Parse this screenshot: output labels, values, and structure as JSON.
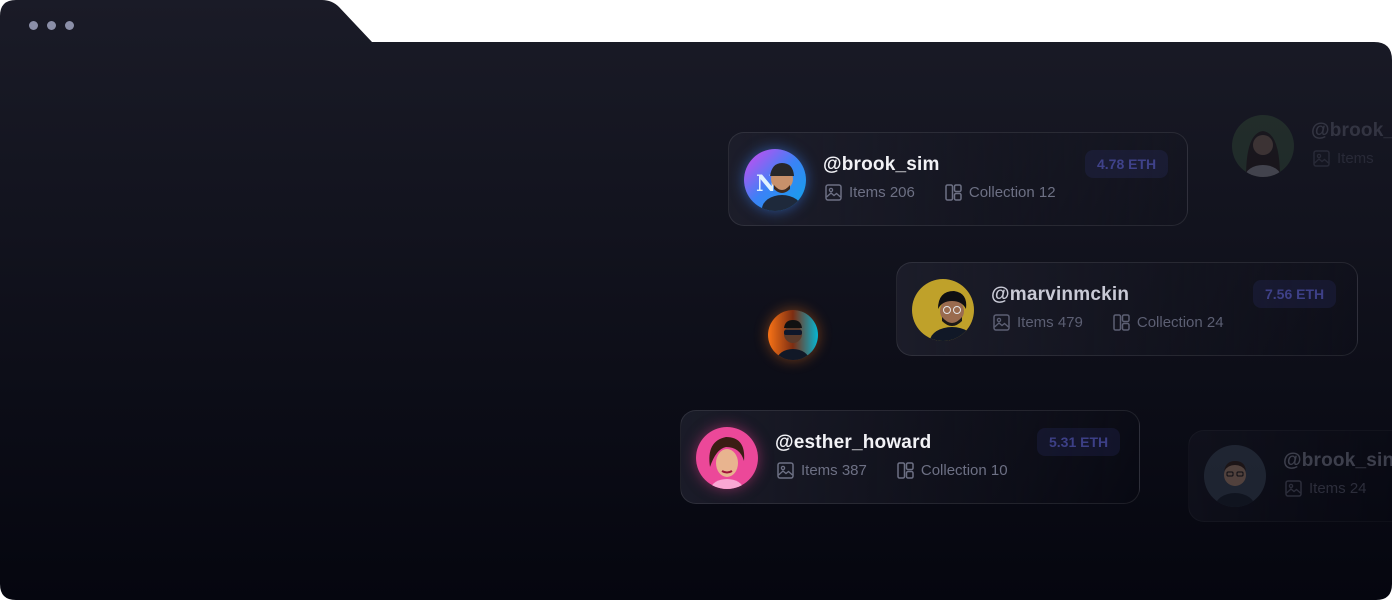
{
  "window": {
    "colors": {
      "bg_top": "#191a26",
      "bg_bottom": "#05060f",
      "tab": "#191a26",
      "dots": "#8b8fa8"
    }
  },
  "cards": [
    {
      "handle": "@brook_sim",
      "items_label": "Items 206",
      "collection_label": "Collection 12",
      "price": "4.78 ETH",
      "avatar_icon": "avatar-man-beanie-neon",
      "accent": "#3b82f6"
    },
    {
      "handle": "@marvinmckin",
      "items_label": "Items 479",
      "collection_label": "Collection 24",
      "price": "7.56 ETH",
      "avatar_icon": "avatar-man-yellow-bg",
      "accent": "#c9a52a"
    },
    {
      "handle": "@esther_howard",
      "items_label": "Items 387",
      "collection_label": "Collection 10",
      "price": "5.31 ETH",
      "avatar_icon": "avatar-woman-pink-bg",
      "accent": "#e83e8c"
    }
  ],
  "ghost_cards": [
    {
      "handle": "@brook_",
      "items_label": "Items",
      "avatar_icon": "avatar-woman-green"
    },
    {
      "handle": "@brook_sin",
      "items_label": "Items 24",
      "avatar_icon": "avatar-man-glasses"
    }
  ],
  "floating_avatar": {
    "avatar_icon": "avatar-man-neon-city",
    "accent": "#f97316"
  }
}
